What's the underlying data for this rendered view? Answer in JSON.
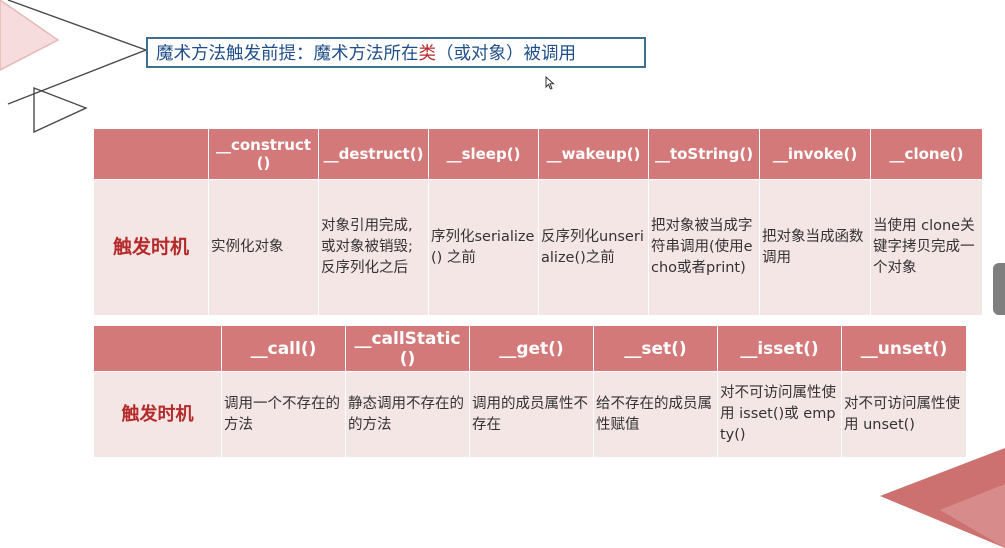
{
  "header": {
    "title_prefix": "魔术方法触发前提：魔术方法所在",
    "title_highlight": "类",
    "title_suffix": "（或对象）被调用"
  },
  "table1": {
    "row_label": "触发时机",
    "columns": [
      {
        "name": "__construct()",
        "trigger": "实例化对象"
      },
      {
        "name": "__destruct()",
        "trigger": "对象引用完成,或对象被销毁;反序列化之后"
      },
      {
        "name": "__sleep()",
        "trigger": "序列化serialize() 之前"
      },
      {
        "name": "__wakeup()",
        "trigger": "反序列化unserialize()之前"
      },
      {
        "name": "__toString()",
        "trigger": "把对象被当成字符串调用(使用echo或者print)"
      },
      {
        "name": "__invoke()",
        "trigger": "把对象当成函数调用"
      },
      {
        "name": "__clone()",
        "trigger": "当使用 clone关键字拷贝完成一个对象"
      }
    ]
  },
  "table2": {
    "row_label": "触发时机",
    "columns": [
      {
        "name": "__call()",
        "trigger": "调用一个不存在的方法"
      },
      {
        "name": "__callStatic()",
        "trigger": "静态调用不存在的的方法"
      },
      {
        "name": "__get()",
        "trigger": "调用的成员属性不存在"
      },
      {
        "name": "__set()",
        "trigger": "给不存在的成员属性赋值"
      },
      {
        "name": "__isset()",
        "trigger": "对不可访问属性使用 isset()或 empty()"
      },
      {
        "name": "__unset()",
        "trigger": "对不可访问属性使用 unset()"
      }
    ]
  },
  "colors": {
    "header_red": "#d37979",
    "body_pink": "#f5e6e6",
    "label_red": "#b52a2a",
    "title_blue": "#1f4f8a"
  },
  "icons": {
    "cursor": "mouse-pointer-icon",
    "scroll": "scroll-handle"
  }
}
